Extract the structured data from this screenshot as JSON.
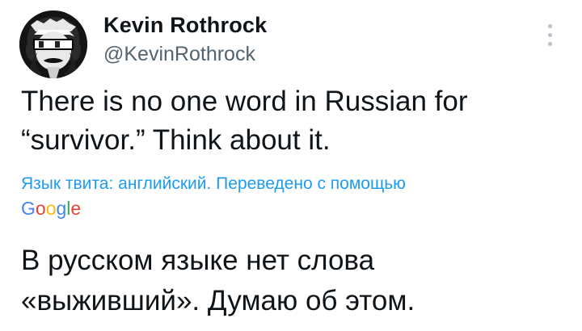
{
  "author": {
    "display_name": "Kevin Rothrock",
    "handle": "@KevinRothrock"
  },
  "tweet": {
    "text": "There is no one word in Russian for\n“survivor.” Think about it."
  },
  "translation": {
    "note": "Язык твита: английский. Переведено с помощью",
    "provider_logo": "Google",
    "provider_letters": [
      "G",
      "o",
      "o",
      "g",
      "l",
      "e"
    ],
    "provider_colors": [
      "#4285f4",
      "#ea4335",
      "#fbbc05",
      "#4285f4",
      "#34a853",
      "#ea4335"
    ],
    "text": "В русском языке нет слова\n«выживший». Думаю об этом."
  },
  "colors": {
    "link": "#1d9bf0",
    "secondary_text": "#536471",
    "primary_text": "#0f1419"
  },
  "icons": {
    "avatar": "avatar-icon",
    "more": "more-vertical-icon"
  }
}
